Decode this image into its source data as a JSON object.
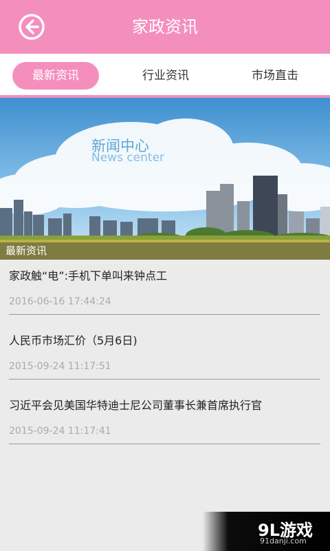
{
  "header": {
    "title": "家政资讯",
    "back_icon": "back-arrow-icon"
  },
  "tabs": [
    {
      "label": "最新资讯",
      "active": true
    },
    {
      "label": "行业资讯",
      "active": false
    },
    {
      "label": "市场直击",
      "active": false
    }
  ],
  "banner": {
    "title": "新闻中心",
    "subtitle": "News center"
  },
  "section": {
    "label": "最新资讯"
  },
  "news": [
    {
      "title": "家政触“电”:手机下单叫来钟点工",
      "date": "2016-06-16 17:44:24"
    },
    {
      "title": "人民币市场汇价（5月6日)",
      "date": "2015-09-24 11:17:51"
    },
    {
      "title": "习近平会见美国华特迪士尼公司董事长兼首席执行官",
      "date": "2015-09-24 11:17:41"
    }
  ],
  "watermark": {
    "brand": "9L游戏",
    "url": "91danji.com"
  },
  "colors": {
    "accent": "#f48fbd"
  }
}
